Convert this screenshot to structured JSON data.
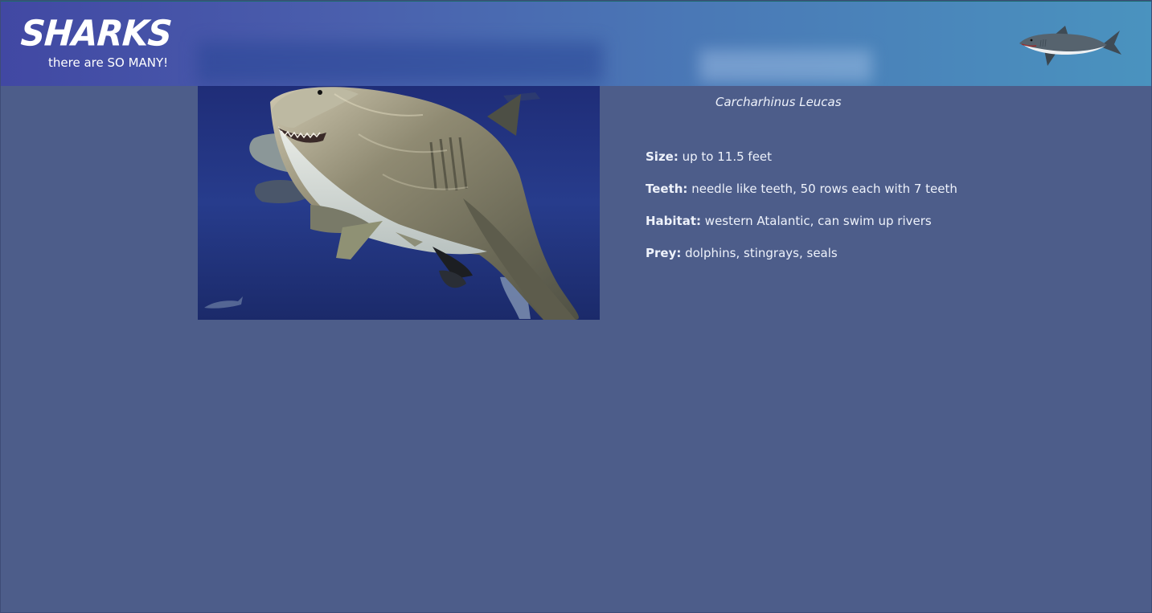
{
  "header": {
    "logo": "SHARKS",
    "tagline": "there are SO MANY!",
    "logo_icon": "shark-icon"
  },
  "shark": {
    "image": "bull-shark-photo",
    "scientific_name": "Carcharhinus Leucas",
    "facts": [
      {
        "label": "Size:",
        "value": " up to 11.5 feet"
      },
      {
        "label": "Teeth:",
        "value": " needle like teeth, 50 rows each with 7 teeth"
      },
      {
        "label": "Habitat:",
        "value": " western Atalantic, can swim up rivers"
      },
      {
        "label": "Prey:",
        "value": " dolphins, stingrays, seals"
      }
    ]
  },
  "colors": {
    "page_background": "#4d5d8a",
    "header_start": "#4148a3",
    "header_end": "#4a93bf",
    "text": "#eef2fb"
  }
}
